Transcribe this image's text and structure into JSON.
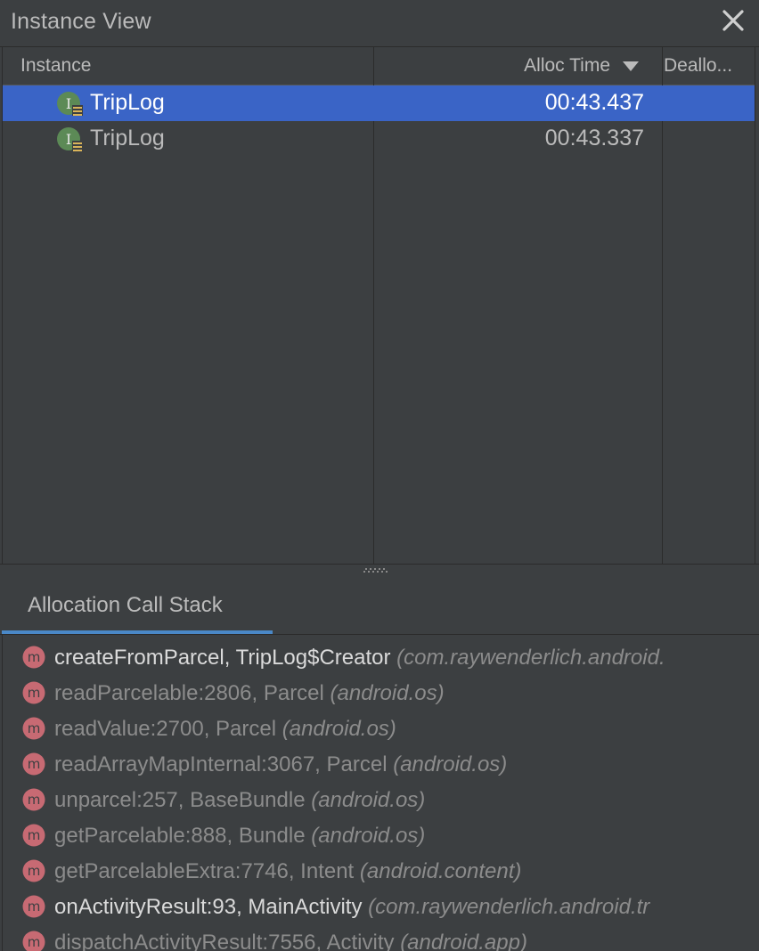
{
  "window": {
    "title": "Instance View",
    "close_icon": "close-icon"
  },
  "table": {
    "columns": [
      {
        "label": "Instance"
      },
      {
        "label": "Alloc Time",
        "sort": "descending"
      },
      {
        "label": "Deallo..."
      }
    ],
    "rows": [
      {
        "icon": "instance-class-icon",
        "name": "TripLog",
        "alloc_time": "00:43.437",
        "selected": true
      },
      {
        "icon": "instance-class-icon",
        "name": "TripLog",
        "alloc_time": "00:43.337",
        "selected": false
      }
    ]
  },
  "bottom": {
    "tabs": [
      {
        "label": "Allocation Call Stack",
        "active": true
      }
    ],
    "frames": [
      {
        "method": "createFromParcel, TripLog$Creator",
        "pkg": "(com.raywenderlich.android.",
        "own": true
      },
      {
        "method": "readParcelable:2806, Parcel",
        "pkg": "(android.os)",
        "own": false
      },
      {
        "method": "readValue:2700, Parcel",
        "pkg": "(android.os)",
        "own": false
      },
      {
        "method": "readArrayMapInternal:3067, Parcel",
        "pkg": "(android.os)",
        "own": false
      },
      {
        "method": "unparcel:257, BaseBundle",
        "pkg": "(android.os)",
        "own": false
      },
      {
        "method": "getParcelable:888, Bundle",
        "pkg": "(android.os)",
        "own": false
      },
      {
        "method": "getParcelableExtra:7746, Intent",
        "pkg": "(android.content)",
        "own": false
      },
      {
        "method": "onActivityResult:93, MainActivity",
        "pkg": "(com.raywenderlich.android.tr",
        "own": true
      },
      {
        "method": "dispatchActivityResult:7556, Activity",
        "pkg": "(android.app)",
        "own": false
      }
    ]
  },
  "colors": {
    "background": "#3c3f41",
    "selection": "#3a64c6",
    "tab_underline": "#4a88c7",
    "method_icon": "#c76a73",
    "class_icon": "#5c8a56"
  }
}
